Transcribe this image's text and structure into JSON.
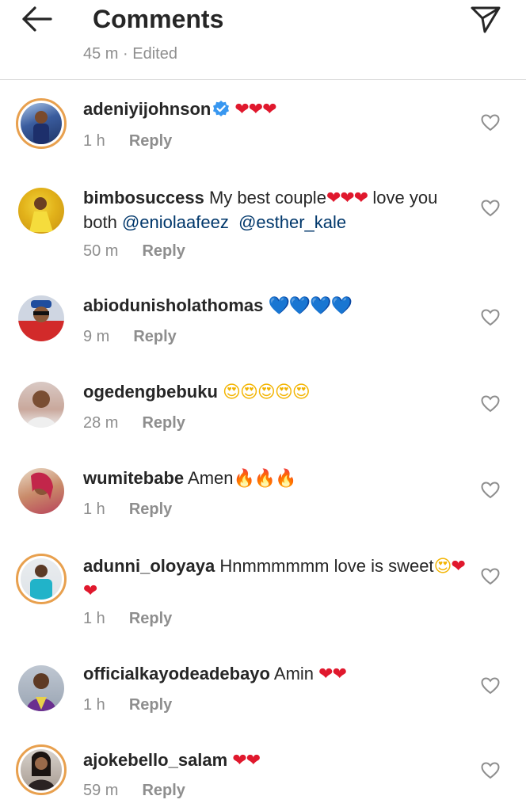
{
  "header": {
    "title": "Comments",
    "back_icon": "arrow-left-icon",
    "send_icon": "paper-plane-icon"
  },
  "previous_comment": {
    "meta": "45 m · Edited"
  },
  "comments": [
    {
      "username": "adeniyijohnson",
      "verified": true,
      "text": "",
      "emoji": "❤❤❤",
      "time": "1 h",
      "reply": "Reply"
    },
    {
      "username": "bimbosuccess",
      "text_a": "My best couple",
      "emoji": "❤❤❤",
      "text_b": "love you both",
      "mention1": "@eniolaafeez",
      "mention2": "@esther_kale",
      "time": "50 m",
      "reply": "Reply"
    },
    {
      "username": "abiodunisholathomas",
      "text": "",
      "emoji": "💙💙💙💙",
      "time": "9 m",
      "reply": "Reply"
    },
    {
      "username": "ogedengbebuku",
      "text": "",
      "emoji": "😍😍😍😍😍",
      "time": "28 m",
      "reply": "Reply"
    },
    {
      "username": "wumitebabe",
      "text": "Amen",
      "emoji": "🔥🔥🔥",
      "time": "1 h",
      "reply": "Reply"
    },
    {
      "username": "adunni_oloyaya",
      "text_a": "Hnmmmmmm love is sweet",
      "emoji_smile": "😍",
      "emoji": "❤❤",
      "time": "1 h",
      "reply": "Reply"
    },
    {
      "username": "officialkayodeadebayo",
      "text": "Amin",
      "emoji": "❤❤",
      "time": "1 h",
      "reply": "Reply"
    },
    {
      "username": "ajokebello_salam",
      "text": "",
      "emoji": "❤❤",
      "time": "59 m",
      "reply": "Reply"
    }
  ],
  "colors": {
    "text": "#262626",
    "secondary": "#8e8e8e",
    "mention": "#00376b",
    "verified": "#3897f0",
    "story_ring": "#e8a04e"
  }
}
